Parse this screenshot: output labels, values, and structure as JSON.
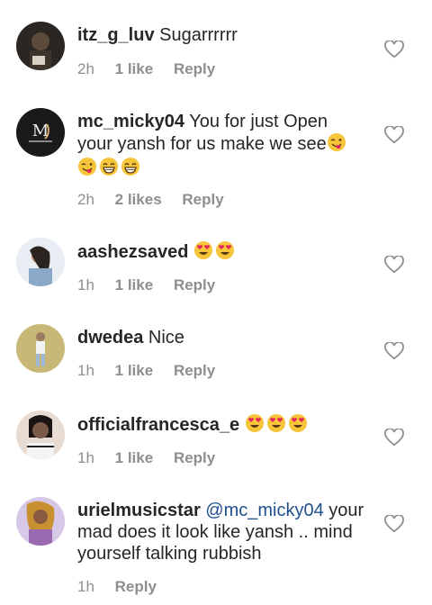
{
  "comments": [
    {
      "username": "itz_g_luv",
      "text": "Sugarrrrrr",
      "mention": "",
      "time": "2h",
      "likes": "1 like",
      "reply": "Reply",
      "emojis": [],
      "avatar_color": "#5c4a3a"
    },
    {
      "username": "mc_micky04",
      "text_line1": "You for just Open",
      "text_line2": "your yansh for us make we see",
      "time": "2h",
      "likes": "2 likes",
      "reply": "Reply",
      "emojis_line2": [
        "tongue-wink"
      ],
      "emojis_line3": [
        "tongue-wink",
        "grin",
        "grin"
      ],
      "avatar_color": "#1a1a1a"
    },
    {
      "username": "aashezsaved",
      "text": "",
      "time": "1h",
      "likes": "1 like",
      "reply": "Reply",
      "emojis": [
        "heart-eyes",
        "heart-eyes"
      ],
      "avatar_color": "#8aa9c8"
    },
    {
      "username": "dwedea",
      "text": "Nice",
      "time": "1h",
      "likes": "1 like",
      "reply": "Reply",
      "emojis": [],
      "avatar_color": "#c8b878"
    },
    {
      "username": "officialfrancesca_e",
      "text": "",
      "time": "1h",
      "likes": "1 like",
      "reply": "Reply",
      "emojis": [
        "heart-eyes",
        "heart-eyes",
        "heart-eyes"
      ],
      "avatar_color": "#7a5a48"
    },
    {
      "username": "urielmusicstar",
      "mention": "@mc_micky04",
      "text_line1": "your",
      "text_line2": "mad does it look like yansh .. mind",
      "text_line3": "yourself talking rubbish",
      "time": "1h",
      "reply": "Reply",
      "avatar_color": "#9a6ab0"
    }
  ],
  "colors": {
    "meta_text": "#8e8e8e",
    "username": "#262626",
    "mention": "#1f4f8f",
    "emoji_yellow": "#f7c53a",
    "heart_red": "#e0245e"
  }
}
